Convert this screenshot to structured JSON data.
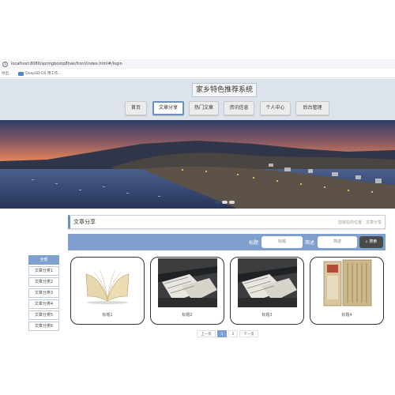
{
  "browser": {
    "url": "localhost:8080/springbootp8hak/front/index.html#/login",
    "bookmarks": [
      "导出...",
      "DeepSD-DS 用工作..."
    ]
  },
  "header": {
    "site_title": "家乡特色推荐系统",
    "nav": [
      "首页",
      "文章分享",
      "热门文章",
      "资讯信息",
      "个人中心",
      "后台管理"
    ],
    "active_nav": "文章分享"
  },
  "banner": {
    "dots": 2,
    "active_dot": 1
  },
  "section": {
    "title": "文章分享",
    "breadcrumb": "您现在的位置：文章分享"
  },
  "search": {
    "title_label": "标题",
    "title_placeholder": "标题",
    "desc_label": "简述",
    "desc_placeholder": "简述",
    "button_label": "搜索"
  },
  "sidebar": {
    "items": [
      "全部",
      "文章分类1",
      "文章分类2",
      "文章分类3",
      "文章分类4",
      "文章分类5",
      "文章分类6"
    ],
    "active": "全部"
  },
  "cards": [
    {
      "caption": "标题1",
      "image": "open-book"
    },
    {
      "caption": "标题2",
      "image": "newspaper-press"
    },
    {
      "caption": "标题3",
      "image": "newspaper-press"
    },
    {
      "caption": "标题4",
      "image": "old-documents"
    }
  ],
  "pagination": {
    "prev": "上一页",
    "pages": [
      "1",
      "2"
    ],
    "current": "1",
    "next": "下一页"
  },
  "colors": {
    "accent": "#7f9fcf",
    "header_bg": "#dde3ea",
    "search_button": "#4a4a4a"
  }
}
